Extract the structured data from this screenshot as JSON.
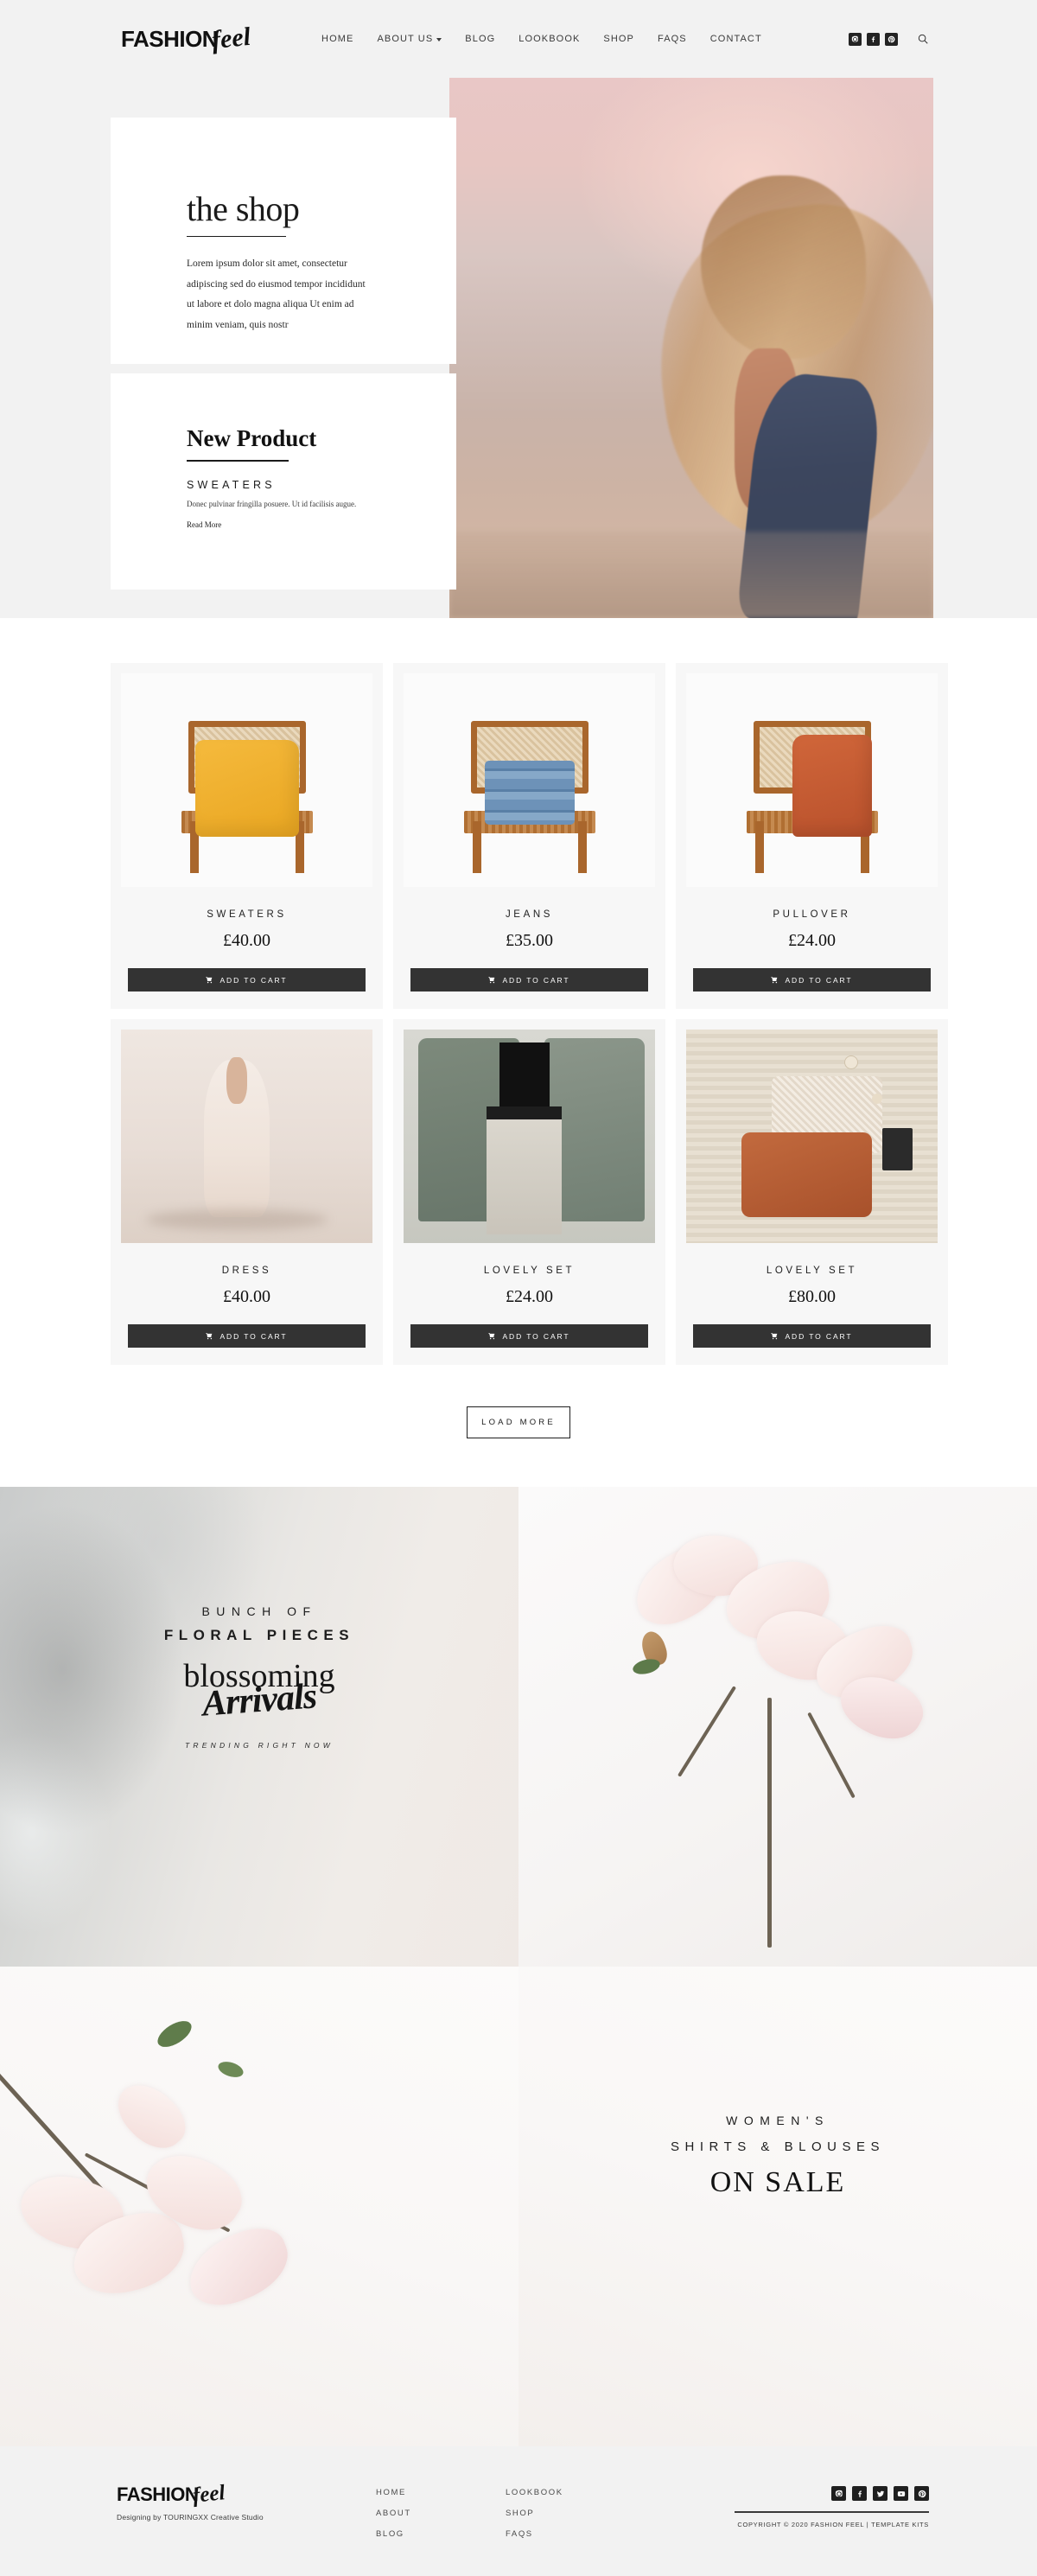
{
  "header": {
    "logo_main": "FASHION",
    "logo_script": "feel",
    "nav": [
      {
        "label": "HOME",
        "has_dropdown": false
      },
      {
        "label": "ABOUT US",
        "has_dropdown": true
      },
      {
        "label": "BLOG",
        "has_dropdown": false
      },
      {
        "label": "LOOKBOOK",
        "has_dropdown": false
      },
      {
        "label": "SHOP",
        "has_dropdown": false
      },
      {
        "label": "FAQS",
        "has_dropdown": false
      },
      {
        "label": "CONTACT",
        "has_dropdown": false
      }
    ],
    "socials": [
      "instagram-icon",
      "facebook-icon",
      "pinterest-icon"
    ],
    "search_icon": "search-icon"
  },
  "hero": {
    "card_shop": {
      "title": "the shop",
      "body": "Lorem ipsum dolor sit amet, consectetur adipiscing sed do eiusmod tempor incididunt ut labore et dolo magna aliqua Ut enim ad minim veniam, quis nostr"
    },
    "card_new": {
      "title": "New Product",
      "subtitle": "SWEATERS",
      "body": "Donec pulvinar fringilla posuere. Ut id facilisis augue.",
      "link": "Read More"
    },
    "photo_alt": "woman-with-long-hair-at-sunset-beach"
  },
  "products": {
    "add_to_cart_label": "ADD TO CART",
    "cart_icon": "cart-icon",
    "load_more_label": "LOAD MORE",
    "items": [
      {
        "name": "SWEATERS",
        "price": "£40.00",
        "image": "yellow-sweater-on-wooden-chair"
      },
      {
        "name": "JEANS",
        "price": "£35.00",
        "image": "folded-blue-jeans-on-wooden-chair"
      },
      {
        "name": "PULLOVER",
        "price": "£24.00",
        "image": "rust-pullover-on-wooden-chair"
      },
      {
        "name": "DRESS",
        "price": "£40.00",
        "image": "woman-in-cream-dress-walking"
      },
      {
        "name": "LOVELY SET",
        "price": "£24.00",
        "image": "green-coats-and-white-trousers"
      },
      {
        "name": "LOVELY SET",
        "price": "£80.00",
        "image": "knitwear-and-lace-flatlay"
      }
    ]
  },
  "banners": [
    {
      "line1": "BUNCH OF",
      "line2": "FLORAL PIECES",
      "script1": "blossoming",
      "script2": "Arrivals",
      "footnote": "TRENDING RIGHT NOW",
      "image": "concrete-texture-background"
    },
    {
      "image": "pink-magnolia-branch-on-white"
    },
    {
      "image": "magnolia-blossoms-branch"
    },
    {
      "line1": "WOMEN'S",
      "line2": "SHIRTS & BLOUSES",
      "line3": "ON SALE"
    }
  ],
  "footer": {
    "logo_main": "FASHION",
    "logo_script": "feel",
    "tagline": "Designing by TOURINGXX Creative Studio",
    "col1": [
      "HOME",
      "ABOUT",
      "BLOG"
    ],
    "col2": [
      "LOOKBOOK",
      "SHOP",
      "FAQS"
    ],
    "socials": [
      "instagram-icon",
      "facebook-icon",
      "twitter-icon",
      "youtube-icon",
      "pinterest-icon"
    ],
    "copyright": "COPYRIGHT © 2020 FASHION FEEL | TEMPLATE KITS"
  }
}
